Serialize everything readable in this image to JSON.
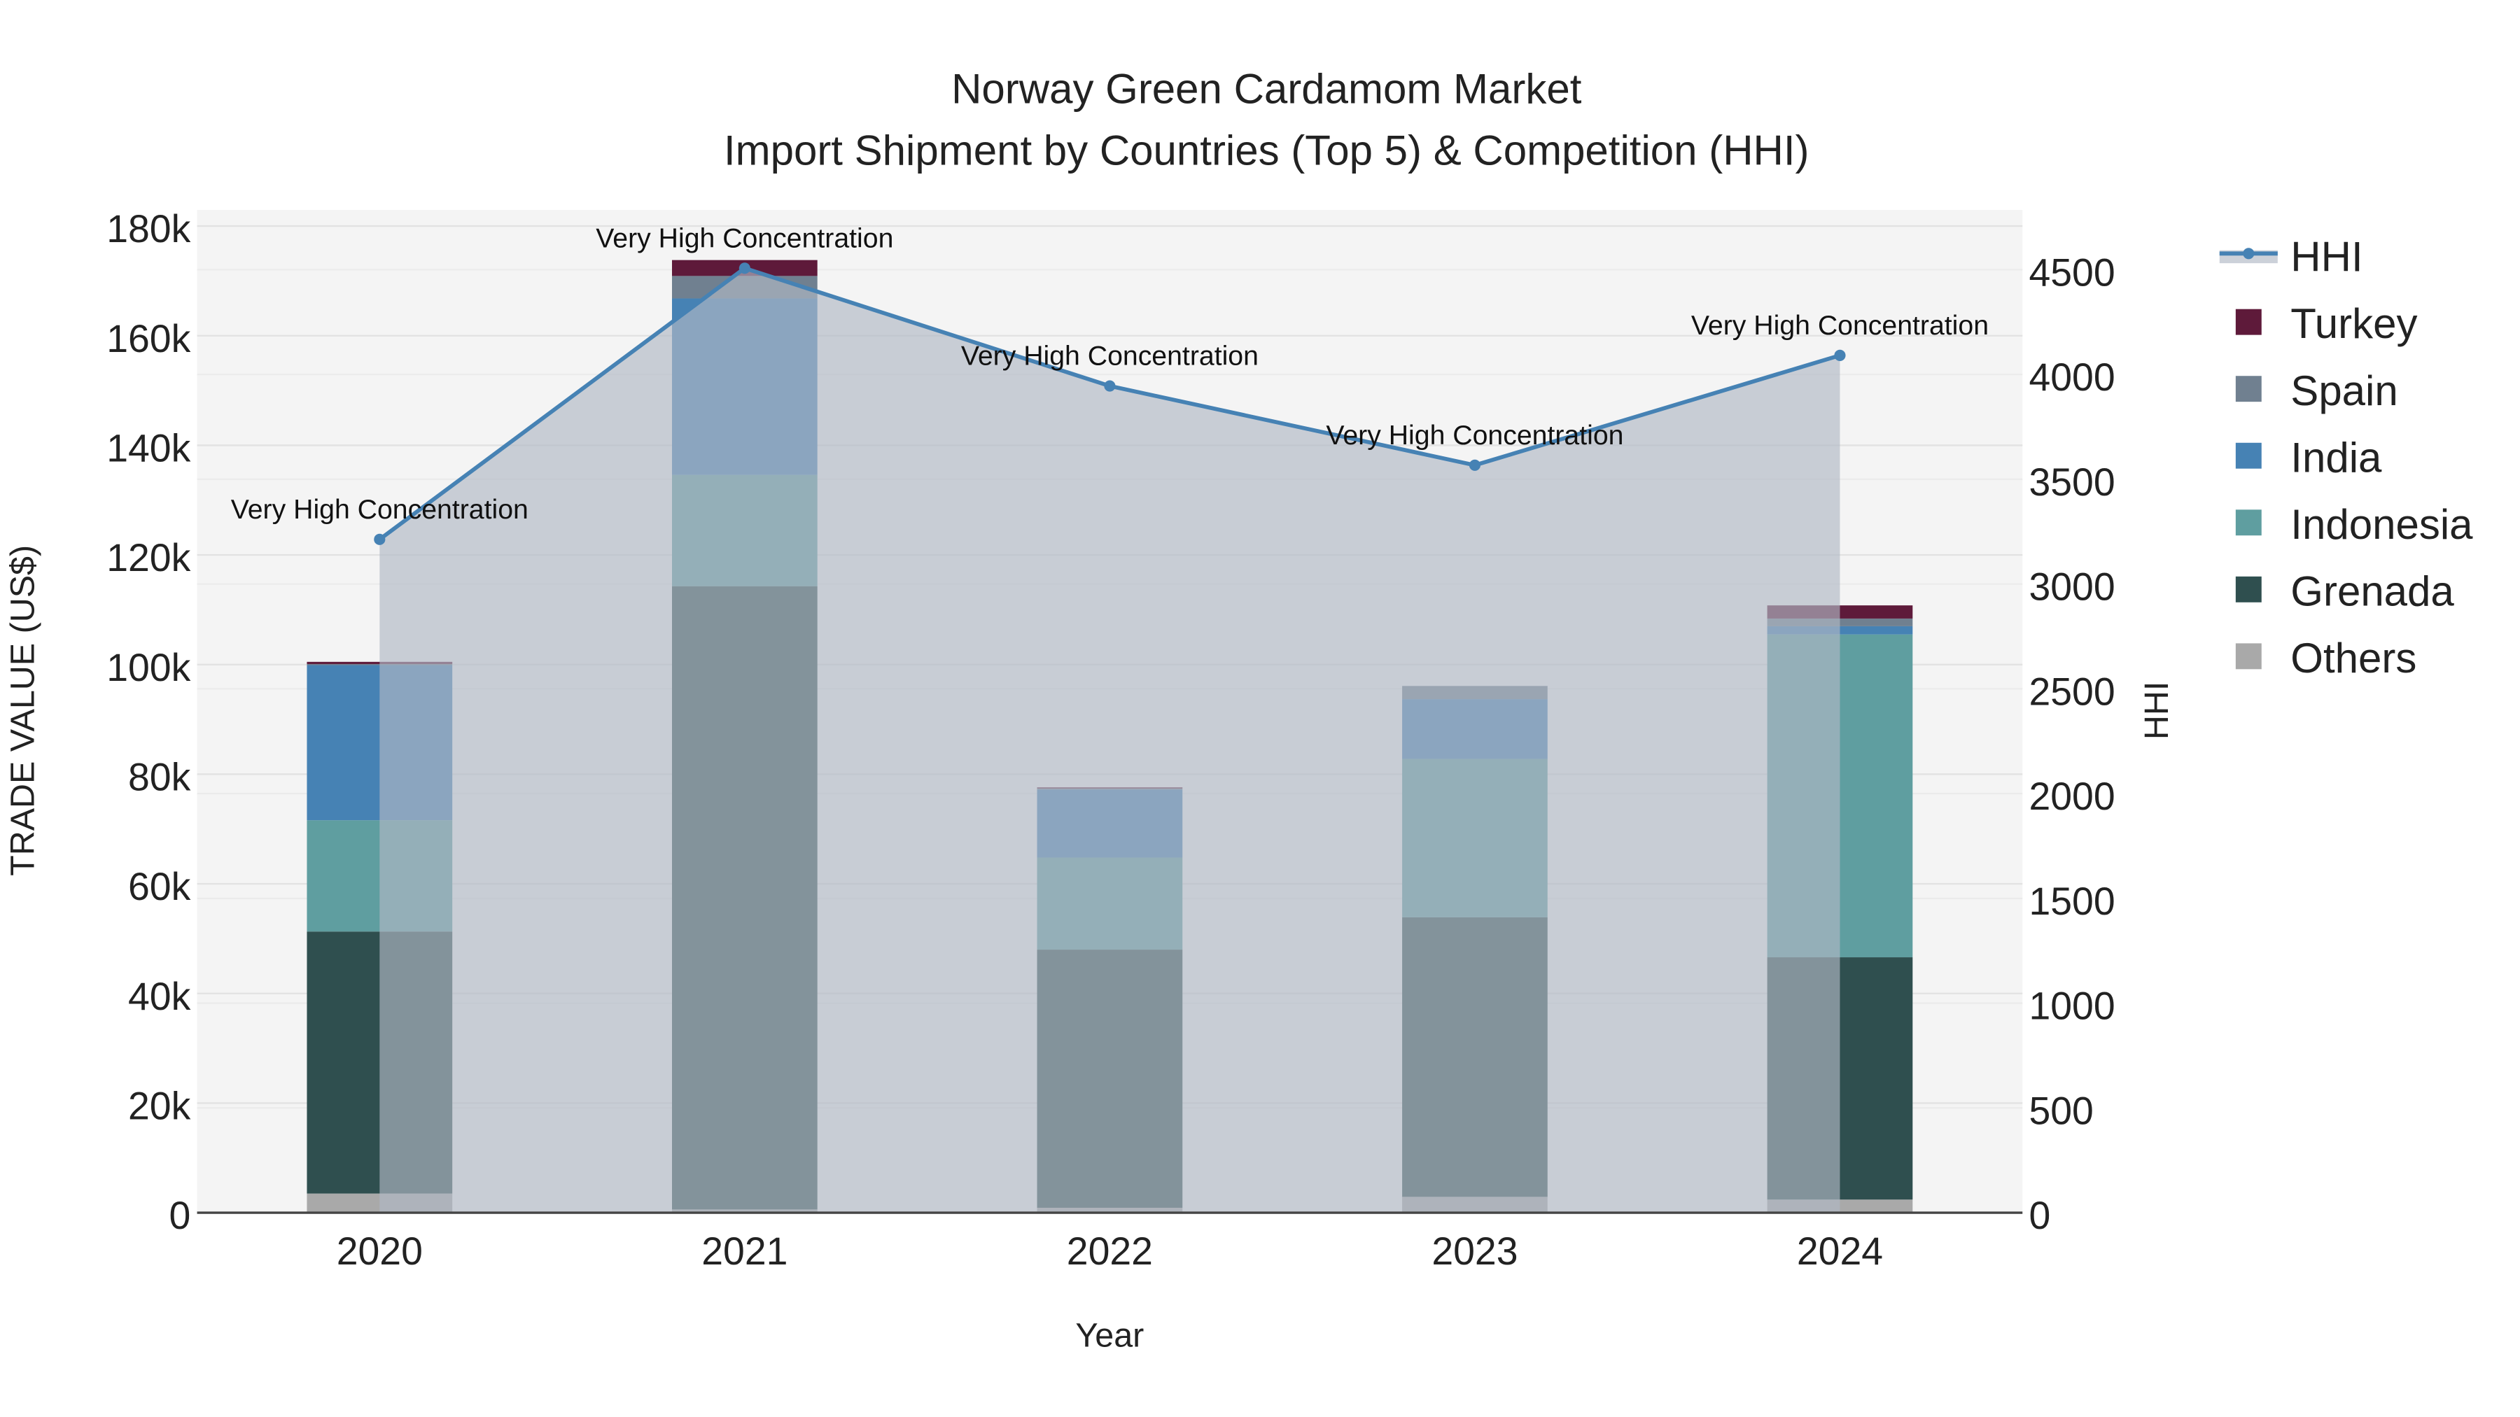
{
  "chart_data": {
    "type": "bar",
    "title_line1": "Norway Green Cardamom Market",
    "title_line2": "Import Shipment by Countries (Top 5) & Competition (HHI)",
    "xlabel": "Year",
    "ylabel": "TRADE VALUE (US$)",
    "y2label": "HHI",
    "categories": [
      "2020",
      "2021",
      "2022",
      "2023",
      "2024"
    ],
    "ylim": [
      0,
      180000
    ],
    "y2lim": [
      0,
      4700
    ],
    "yticks": [
      0,
      20000,
      40000,
      60000,
      80000,
      100000,
      120000,
      140000,
      160000,
      180000
    ],
    "ytick_labels": [
      "0",
      "20k",
      "40k",
      "60k",
      "80k",
      "100k",
      "120k",
      "140k",
      "160k",
      "180k"
    ],
    "y2ticks": [
      0,
      500,
      1000,
      1500,
      2000,
      2500,
      3000,
      3500,
      4000,
      4500
    ],
    "y2tick_labels": [
      "0",
      "500",
      "1000",
      "1500",
      "2000",
      "2500",
      "3000",
      "3500",
      "4000",
      "4500"
    ],
    "stacked": true,
    "series": [
      {
        "name": "Others",
        "color": "#a9a9a9",
        "values": [
          3500,
          600,
          900,
          2900,
          2400
        ]
      },
      {
        "name": "Grenada",
        "color": "#2f4f4f",
        "values": [
          47800,
          113700,
          47100,
          51000,
          44200
        ]
      },
      {
        "name": "Indonesia",
        "color": "#5f9ea0",
        "values": [
          20300,
          20300,
          16800,
          28900,
          58900
        ]
      },
      {
        "name": "India",
        "color": "#4682b4",
        "values": [
          28300,
          32200,
          12400,
          10900,
          1500
        ]
      },
      {
        "name": "Spain",
        "color": "#708090",
        "values": [
          200,
          4100,
          200,
          2400,
          1400
        ]
      },
      {
        "name": "Turkey",
        "color": "#5e1a3a",
        "values": [
          400,
          2900,
          200,
          0,
          2400
        ]
      }
    ],
    "line_series": {
      "name": "HHI",
      "color": "#4682b4",
      "axis": "right",
      "values": [
        3213,
        4507,
        3945,
        3567,
        4091
      ]
    },
    "annotations": [
      "Very High Concentration",
      "Very High Concentration",
      "Very High Concentration",
      "Very High Concentration",
      "Very High Concentration"
    ],
    "legend": [
      "HHI",
      "Turkey",
      "Spain",
      "India",
      "Indonesia",
      "Grenada",
      "Others"
    ],
    "legend_placement": "right",
    "grid": true
  }
}
